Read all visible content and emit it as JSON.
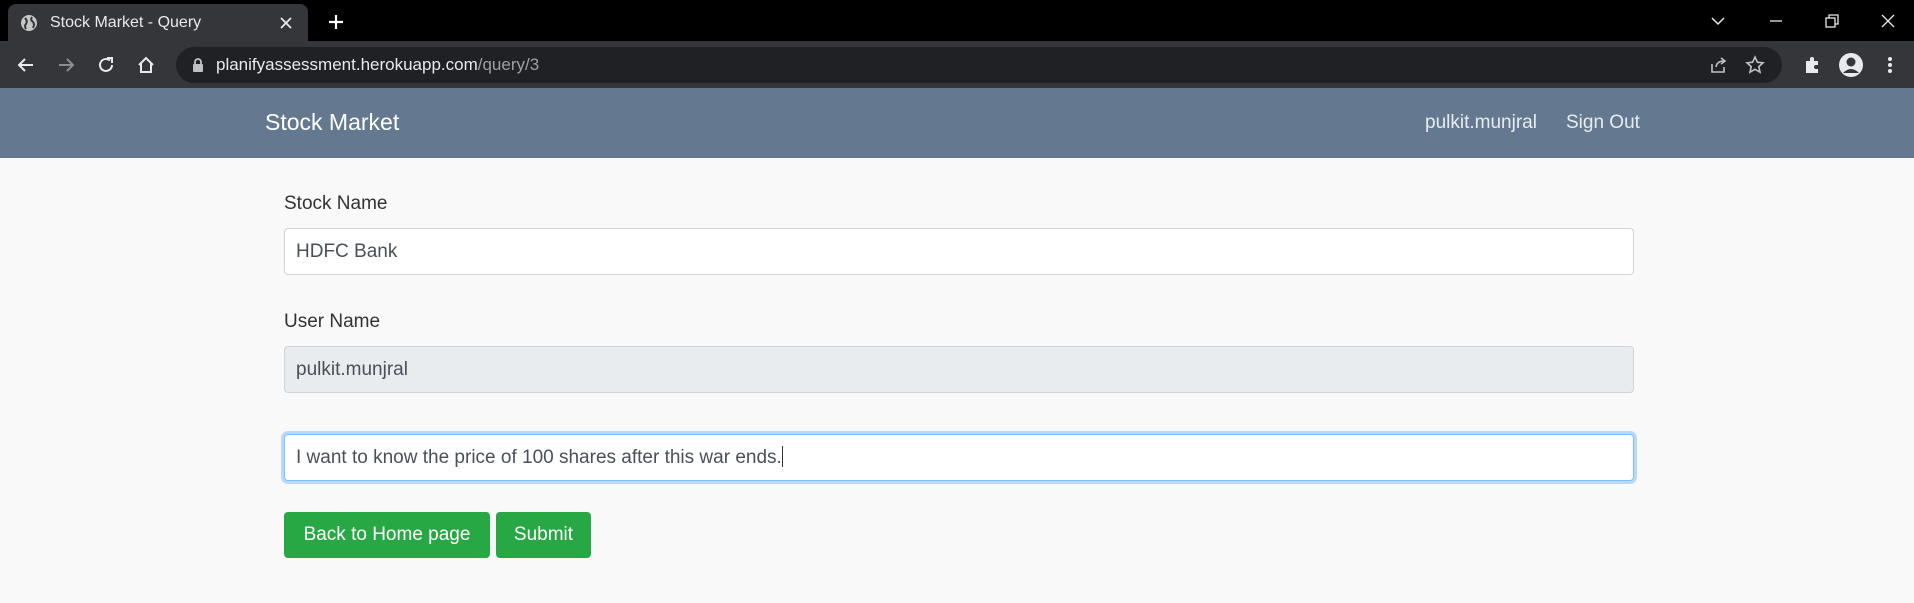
{
  "browser": {
    "tab_title": "Stock Market - Query",
    "url_host": "planifyassessment.herokuapp.com",
    "url_path": "/query/3"
  },
  "navbar": {
    "brand": "Stock Market",
    "username": "pulkit.munjral",
    "sign_out": "Sign Out"
  },
  "form": {
    "stock_label": "Stock Name",
    "stock_value": "HDFC Bank",
    "user_label": "User Name",
    "user_value": "pulkit.munjral",
    "query_value": "I want to know the price of 100 shares after this war ends."
  },
  "buttons": {
    "back": "Back to Home page",
    "submit": "Submit"
  },
  "colors": {
    "navbar": "#64798f",
    "button": "#28a745"
  }
}
